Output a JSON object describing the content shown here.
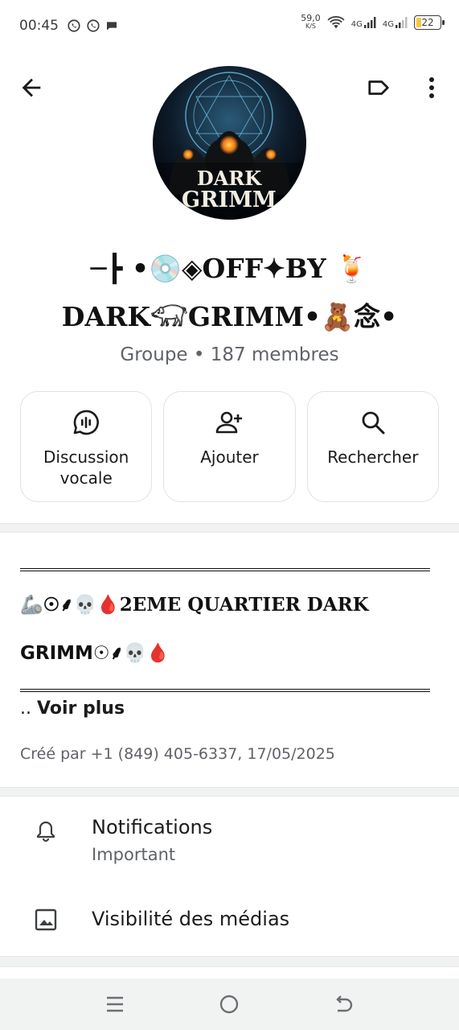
{
  "status": {
    "time": "00:45",
    "speed_value": "59,0",
    "speed_unit": "K/S",
    "net1": "4G",
    "net2": "4G",
    "battery": "22"
  },
  "header": {
    "avatar_line1": "DARK",
    "avatar_line2": "GRIMM"
  },
  "group": {
    "name_line1": "─┣ •💿◈OFF✦BY 🍹",
    "name_line2": "DARK𓃟GRIMM•🧸念•",
    "meta": "Groupe • 187 membres"
  },
  "actions": {
    "voice_label_1": "Discussion",
    "voice_label_2": "vocale",
    "add_label": "Ajouter",
    "search_label": "Rechercher"
  },
  "description": {
    "line1": "🦾☉⸙💀🩸2EME QUARTIER DARK",
    "line2": "GRIMM☉⸙💀🩸",
    "voir_prefix": "..",
    "voir_plus": "Voir plus",
    "created": "Créé par +1 (849) 405-6337, 17/05/2025"
  },
  "settings": {
    "notifications_title": "Notifications",
    "notifications_sub": "Important",
    "media_title": "Visibilité des médias"
  },
  "colors": {
    "accent": "#1b1b1b",
    "muted": "#5f6368",
    "border": "#e0e3e3"
  }
}
